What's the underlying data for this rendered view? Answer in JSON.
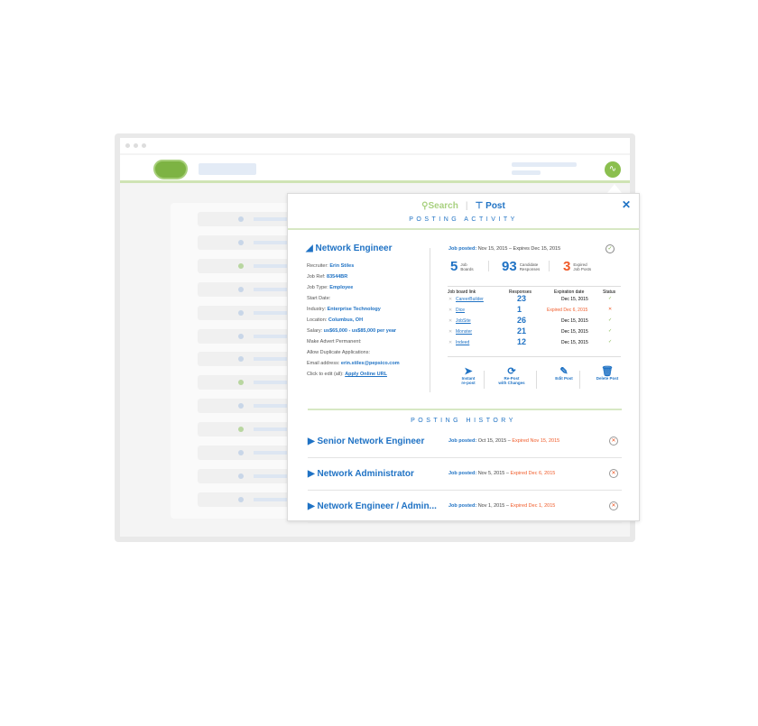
{
  "header": {
    "search_label": "Search",
    "post_label": "Post",
    "close": "✕"
  },
  "activity": {
    "section_title": "POSTING ACTIVITY",
    "job_title": "Network Engineer",
    "details": [
      {
        "label": "Recruiter:",
        "value": "Erin Stiles"
      },
      {
        "label": "Job Ref:",
        "value": "83544BR"
      },
      {
        "label": "Job Type:",
        "value": "Employee"
      },
      {
        "label": "Start Date:",
        "value": ""
      },
      {
        "label": "Industry:",
        "value": "Enterprise Technology"
      },
      {
        "label": "Location:",
        "value": "Columbus, OH"
      },
      {
        "label": "Salary:",
        "value": "us$65,000 - us$85,000 per year"
      },
      {
        "label": "Make Advert Permanent:",
        "value": ""
      },
      {
        "label": "Allow Duplicate Applications:",
        "value": ""
      },
      {
        "label": "Email address:",
        "value": "erin.stiles@pepsico.com"
      },
      {
        "label": "Click to edit (all):",
        "value": "Apply Online URL"
      }
    ],
    "posted_label": "Job posted:",
    "posted_dates": "Nov 15, 2015 – Expires Dec 15, 2015",
    "stats": [
      {
        "n": "5",
        "t1": "Job",
        "t2": "Boards"
      },
      {
        "n": "93",
        "t1": "Candidate",
        "t2": "Responses"
      },
      {
        "n": "3",
        "t1": "Expired",
        "t2": "Job Posts"
      }
    ],
    "columns": [
      "Job board link",
      "Responses",
      "Expiration date",
      "Status"
    ],
    "boards": [
      {
        "name": "CareerBuilder",
        "responses": "23",
        "expiration": "Dec 15, 2015",
        "status": "✓"
      },
      {
        "name": "Dice",
        "responses": "1",
        "expiration": "Expired Dec 6, 2015",
        "status": "✕"
      },
      {
        "name": "JobSite",
        "responses": "26",
        "expiration": "Dec 15, 2015",
        "status": "✓"
      },
      {
        "name": "Monster",
        "responses": "21",
        "expiration": "Dec 15, 2015",
        "status": "✓"
      },
      {
        "name": "Indeed",
        "responses": "12",
        "expiration": "Dec 15, 2015",
        "status": "✓"
      }
    ],
    "actions": [
      {
        "l1": "Instant",
        "l2": "re-post"
      },
      {
        "l1": "Re-Post",
        "l2": "with Changes"
      },
      {
        "l1": "Edit Post",
        "l2": ""
      },
      {
        "l1": "Delete Post",
        "l2": ""
      }
    ]
  },
  "history": {
    "section_title": "POSTING HISTORY",
    "items": [
      {
        "title": "Senior Network Engineer",
        "posted_label": "Job posted:",
        "posted": "Oct 15, 2015 –",
        "expired": "Expired Nov 15, 2015"
      },
      {
        "title": "Network Administrator",
        "posted_label": "Job posted:",
        "posted": "Nov 5, 2015 –",
        "expired": "Expired Dec 6, 2015"
      },
      {
        "title": "Network Engineer / Admin...",
        "posted_label": "Job posted:",
        "posted": "Nov 1, 2015 –",
        "expired": "Expired Dec 1, 2015"
      }
    ]
  },
  "colors": {
    "brand_green": "#7db343",
    "accent_blue": "#1f72c4",
    "expired_red": "#f05a28"
  }
}
